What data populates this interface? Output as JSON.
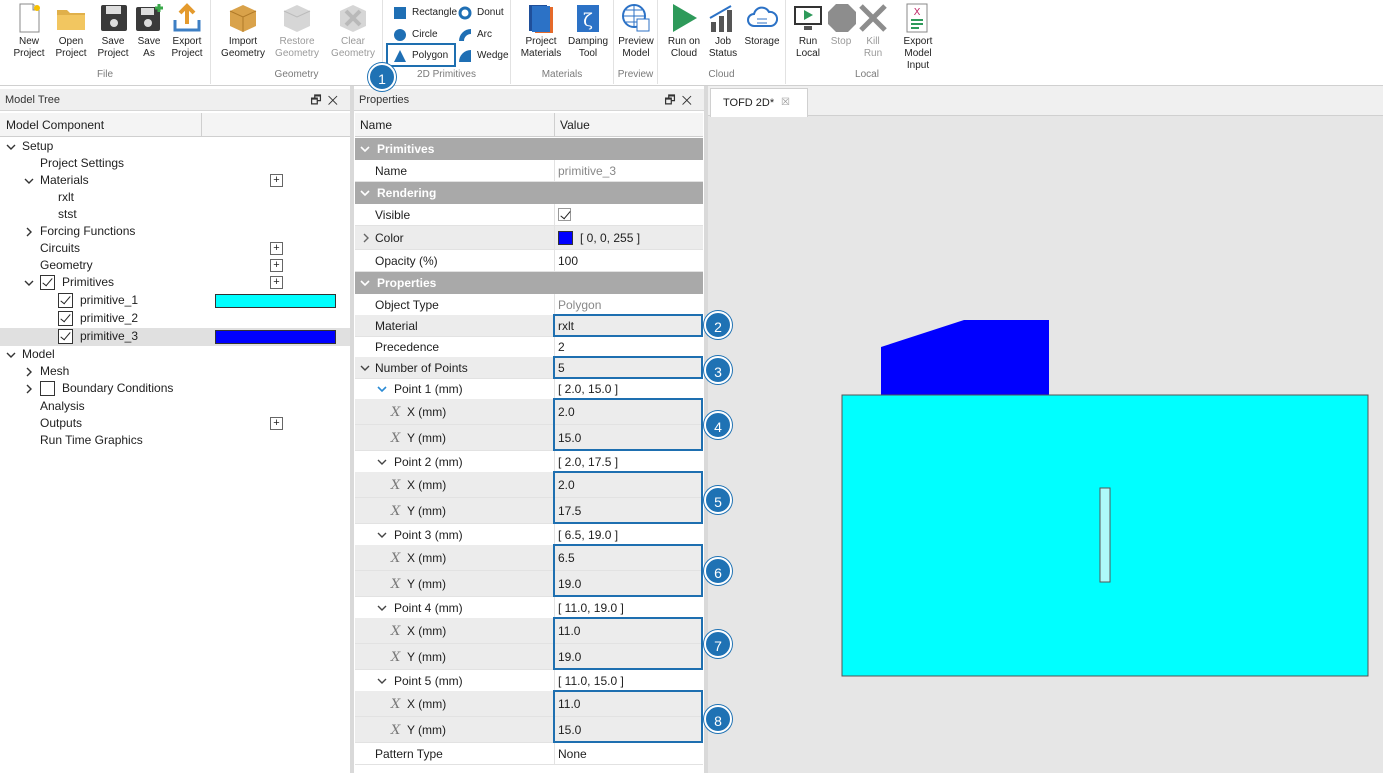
{
  "ribbon": {
    "file_group": "File",
    "geometry_group": "Geometry",
    "primitives_group": "2D Primitives",
    "materials_group": "Materials",
    "preview_group": "Preview",
    "cloud_group": "Cloud",
    "local_group": "Local",
    "new_project": [
      "New",
      "Project"
    ],
    "open_project": [
      "Open",
      "Project"
    ],
    "save_project": [
      "Save",
      "Project"
    ],
    "save_as": [
      "Save",
      "As"
    ],
    "export_project": [
      "Export",
      "Project"
    ],
    "import_geometry": [
      "Import",
      "Geometry"
    ],
    "restore_geometry": [
      "Restore",
      "Geometry"
    ],
    "clear_geometry": [
      "Clear",
      "Geometry"
    ],
    "rectangle": "Rectangle",
    "donut": "Donut",
    "circle": "Circle",
    "arc": "Arc",
    "polygon": "Polygon",
    "wedge": "Wedge",
    "project_materials": [
      "Project",
      "Materials"
    ],
    "damping_tool": [
      "Damping",
      "Tool"
    ],
    "preview_model": [
      "Preview",
      "Model"
    ],
    "run_on_cloud": [
      "Run on",
      "Cloud"
    ],
    "job_status": [
      "Job",
      "Status"
    ],
    "storage": "Storage",
    "run_local": [
      "Run",
      "Local"
    ],
    "stop": "Stop",
    "kill_run": "Kill Run",
    "export_model_input": [
      "Export Model",
      "Input"
    ]
  },
  "model_tree": {
    "title": "Model Tree",
    "column": "Model Component",
    "items": {
      "setup": "Setup",
      "project_settings": "Project Settings",
      "materials": "Materials",
      "rxlt": "rxlt",
      "stst": "stst",
      "forcing_functions": "Forcing Functions",
      "circuits": "Circuits",
      "geometry": "Geometry",
      "primitives": "Primitives",
      "primitive_1": "primitive_1",
      "primitive_2": "primitive_2",
      "primitive_3": "primitive_3",
      "model": "Model",
      "mesh": "Mesh",
      "boundary_conditions": "Boundary Conditions",
      "analysis": "Analysis",
      "outputs": "Outputs",
      "run_time_graphics": "Run Time Graphics"
    },
    "colors": {
      "primitive_1": "#00ffff",
      "primitive_3": "#0000ff"
    }
  },
  "properties": {
    "title": "Properties",
    "col_name": "Name",
    "col_value": "Value",
    "cat_primitives": "Primitives",
    "cat_rendering": "Rendering",
    "cat_properties": "Properties",
    "name_label": "Name",
    "name_value": "primitive_3",
    "visible_label": "Visible",
    "color_label": "Color",
    "color_value": "[ 0, 0, 255 ]",
    "opacity_label": "Opacity (%)",
    "opacity_value": "100",
    "object_type_label": "Object Type",
    "object_type_value": "Polygon",
    "material_label": "Material",
    "material_value": "rxlt",
    "precedence_label": "Precedence",
    "precedence_value": "2",
    "num_points_label": "Number of Points",
    "num_points_value": "5",
    "x_label": "X (mm)",
    "y_label": "Y (mm)",
    "points": [
      {
        "label": "Point 1 (mm)",
        "summary": "[ 2.0, 15.0 ]",
        "x": "2.0",
        "y": "15.0"
      },
      {
        "label": "Point 2 (mm)",
        "summary": "[ 2.0, 17.5 ]",
        "x": "2.0",
        "y": "17.5"
      },
      {
        "label": "Point 3 (mm)",
        "summary": "[ 6.5, 19.0 ]",
        "x": "6.5",
        "y": "19.0"
      },
      {
        "label": "Point 4 (mm)",
        "summary": "[ 11.0, 19.0 ]",
        "x": "11.0",
        "y": "19.0"
      },
      {
        "label": "Point 5 (mm)",
        "summary": "[ 11.0, 15.0 ]",
        "x": "11.0",
        "y": "15.0"
      }
    ],
    "pattern_type_label": "Pattern Type",
    "pattern_type_value": "None"
  },
  "document_tab": "TOFD 2D*",
  "callouts": [
    "1",
    "2",
    "3",
    "4",
    "5",
    "6",
    "7",
    "8"
  ],
  "colors": {
    "accent": "#1e6fb0",
    "cyan": "#00ffff",
    "blue": "#0000ff",
    "category": "#a9a9a9"
  }
}
